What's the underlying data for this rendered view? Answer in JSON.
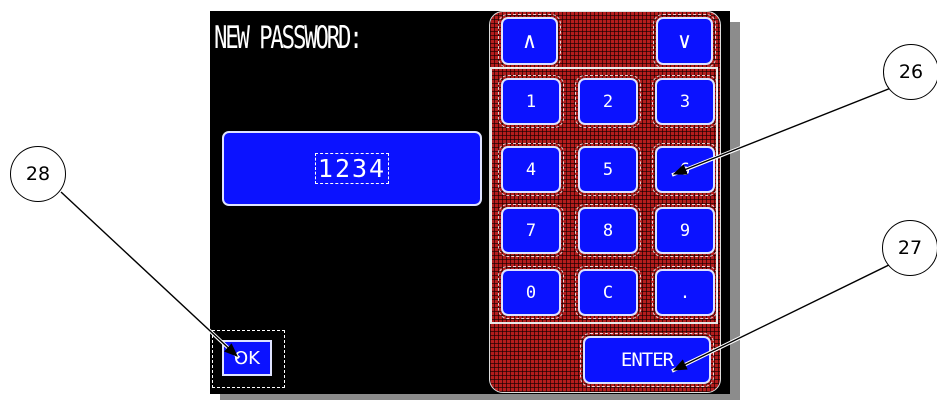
{
  "screen": {
    "title": "NEW PASSWORD:",
    "password_value": "1234",
    "ok_label": "OK"
  },
  "keypad": {
    "arrow_up": "∧",
    "arrow_down": "∨",
    "keys": [
      "1",
      "2",
      "3",
      "4",
      "5",
      "6",
      "7",
      "8",
      "9",
      "0",
      "C",
      "."
    ],
    "enter_label": "ENTER"
  },
  "callouts": {
    "c26": "26",
    "c27": "27",
    "c28": "28"
  },
  "colors": {
    "button_blue": "#0b12ff",
    "keypad_red": "#b51d1d",
    "screen_black": "#000000"
  }
}
